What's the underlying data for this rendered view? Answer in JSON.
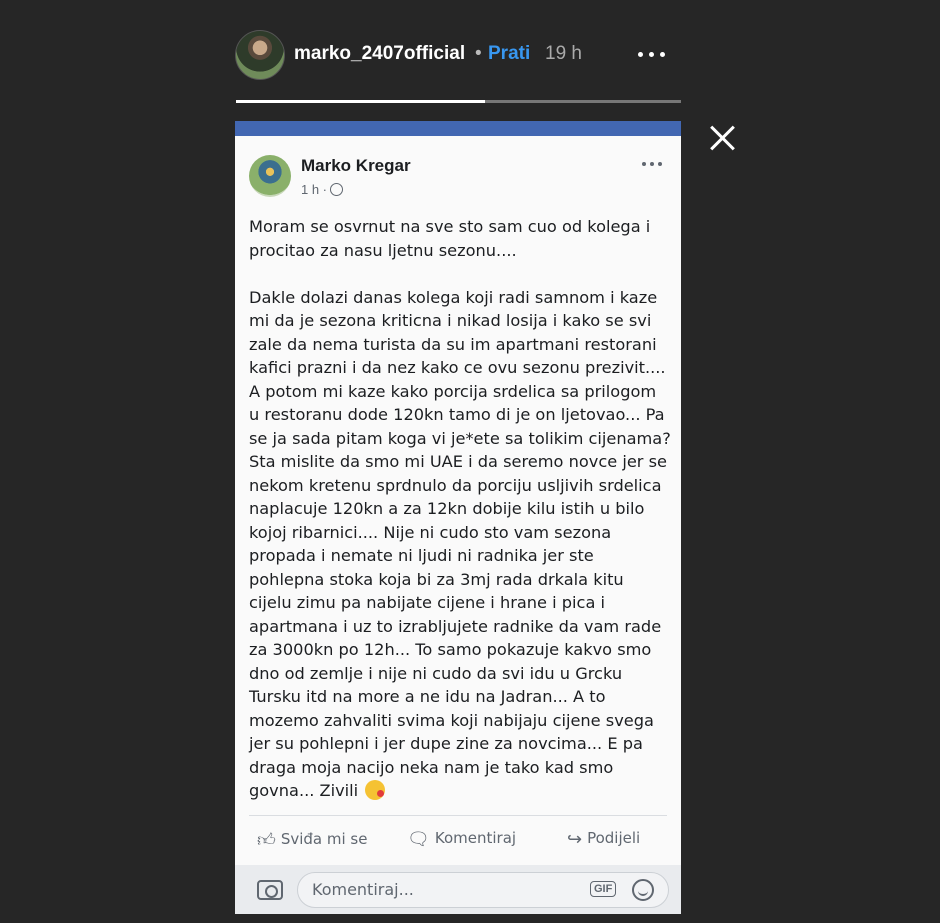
{
  "story": {
    "username": "marko_2407official",
    "separator": "•",
    "follow_label": "Prati",
    "time": "19 h",
    "progress": 0.56
  },
  "post": {
    "author": "Marko Kregar",
    "time": "1 h ·",
    "body": "Moram se osvrnut na sve sto sam cuo od kolega i procitao za nasu ljetnu sezonu....\n\nDakle dolazi danas kolega koji radi samnom i kaze mi da je sezona kriticna i nikad losija i kako se svi zale da nema turista da su im apartmani restorani kafici prazni i da nez kako ce ovu sezonu prezivit.... A potom mi kaze kako porcija srdelica sa prilogom u restoranu dode 120kn tamo di je on ljetovao... Pa se ja sada pitam koga vi je*ete sa tolikim cijenama? Sta mislite da smo mi UAE i da seremo novce jer se nekom kretenu sprdnulo da porciju usljivih srdelica naplacuje 120kn a za 12kn dobije kilu istih u bilo kojoj ribarnici.... Nije ni cudo sto vam sezona propada i nemate ni ljudi ni radnika jer ste pohlepna stoka koja bi za 3mj rada drkala kitu cijelu zimu pa nabijate cijene i hrane i pica i apartmana i uz to izrabljujete radnike da vam rade za 3000kn po 12h... To samo pokazuje kakvo smo dno od zemlje i nije ni cudo da svi idu u Grcku Tursku itd na more a ne idu na Jadran... A to mozemo zahvaliti svima koji nabijaju cijene svega jer su pohlepni i jer dupe zine za novcima... E pa draga moja nacijo neka nam je tako kad smo govna... Zivili",
    "like_label": "Sviđa mi se",
    "comment_label": "Komentiraj",
    "share_label": "Podijeli",
    "comment_placeholder": "Komentiraj...",
    "gif_label": "GIF"
  }
}
